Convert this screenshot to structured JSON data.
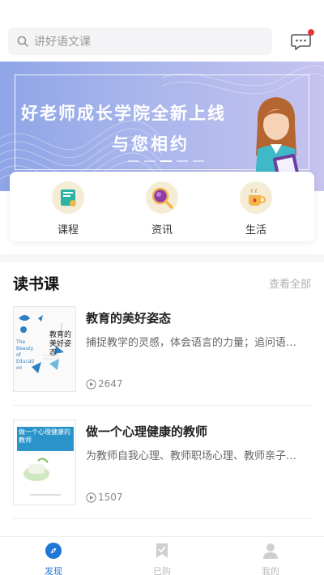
{
  "search": {
    "placeholder": "讲好语文课"
  },
  "banner": {
    "line1": "好老师成长学院全新上线",
    "line2": "与您相约"
  },
  "categories": [
    {
      "label": "课程",
      "icon": "book-badge-icon"
    },
    {
      "label": "资讯",
      "icon": "magnifier-icon"
    },
    {
      "label": "生活",
      "icon": "coffee-cup-icon"
    }
  ],
  "section": {
    "title": "读书课",
    "more": "查看全部"
  },
  "books": [
    {
      "title": "教育的美好姿态",
      "desc": "捕捉教学的灵感，体会语言的力量；追问语…",
      "plays": "2647",
      "cover_text": "教育的美好姿态",
      "cover_en": "The Beauty of Education"
    },
    {
      "title": "做一个心理健康的教师",
      "desc": "为教师自我心理、教师职场心理、教师亲子…",
      "plays": "1507",
      "cover_text": "做一个心理健康的教师"
    }
  ],
  "tabs": [
    {
      "label": "发现",
      "active": true,
      "icon": "compass-icon"
    },
    {
      "label": "已购",
      "active": false,
      "icon": "bookmark-icon"
    },
    {
      "label": "我的",
      "active": false,
      "icon": "person-icon"
    }
  ],
  "colors": {
    "accent": "#1f77d6",
    "badge": "#e53935",
    "banner_start": "#8fa5e7",
    "banner_end": "#c6c3ef"
  }
}
